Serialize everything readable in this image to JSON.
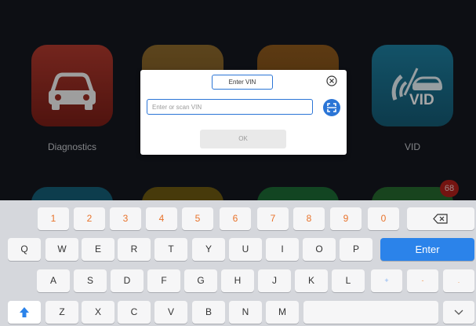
{
  "apps": {
    "diagnostics_label": "Diagnostics",
    "vid_label": "VID",
    "vid_icon_text": "VID",
    "notification_count": "68"
  },
  "dialog": {
    "title": "Enter VIN",
    "input_placeholder": "Enter or scan VIN",
    "ok_label": "OK"
  },
  "keyboard": {
    "numbers": [
      "1",
      "2",
      "3",
      "4",
      "5",
      "6",
      "7",
      "8",
      "9",
      "0"
    ],
    "row_q": [
      "Q",
      "W",
      "E",
      "R",
      "T",
      "Y",
      "U",
      "I",
      "O",
      "P"
    ],
    "row_a": [
      "A",
      "S",
      "D",
      "F",
      "G",
      "H",
      "J",
      "K",
      "L"
    ],
    "row_z": [
      "Z",
      "X",
      "C",
      "V",
      "B",
      "N",
      "M"
    ],
    "enter_label": "Enter",
    "symbols": [
      "+",
      "-",
      "."
    ]
  },
  "colors": {
    "accent": "#2b83ea",
    "number_key": "#e8732b",
    "badge": "#b3201b"
  },
  "icons": [
    "car-icon",
    "vid-icon",
    "close-icon",
    "scan-icon",
    "backspace-icon",
    "shift-icon",
    "hide-keyboard-icon"
  ]
}
